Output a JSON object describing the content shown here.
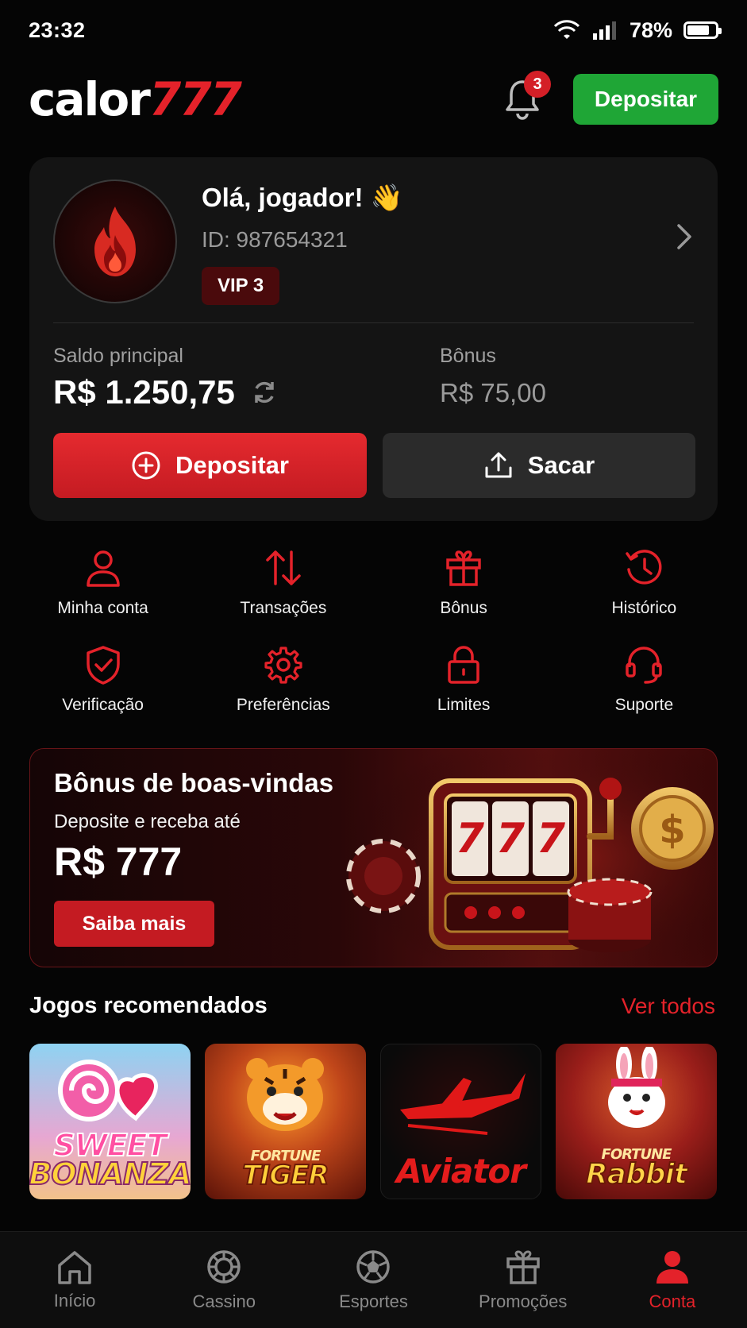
{
  "status": {
    "time": "23:32",
    "battery": "78%",
    "battery_level": 0.78
  },
  "header": {
    "logo_part1": "calor",
    "logo_part2": "777",
    "notification_count": "3",
    "deposit_label": "Depositar"
  },
  "profile": {
    "greeting": "Olá, jogador! 👋",
    "id": "ID: 987654321",
    "vip": "VIP 3",
    "main_balance_label": "Saldo principal",
    "main_balance": "R$ 1.250,75",
    "bonus_label": "Bônus",
    "bonus_value": "R$ 75,00",
    "deposit_label": "Depositar",
    "withdraw_label": "Sacar"
  },
  "actions": [
    {
      "label": "Minha conta",
      "icon": "user-icon"
    },
    {
      "label": "Transações",
      "icon": "arrows-swap-icon"
    },
    {
      "label": "Bônus",
      "icon": "gift-icon"
    },
    {
      "label": "Histórico",
      "icon": "history-icon"
    },
    {
      "label": "Verificação",
      "icon": "shield-check-icon"
    },
    {
      "label": "Preferências",
      "icon": "gear-icon"
    },
    {
      "label": "Limites",
      "icon": "lock-icon"
    },
    {
      "label": "Suporte",
      "icon": "headset-icon"
    }
  ],
  "promo": {
    "title": "Bônus de boas-vindas",
    "subtitle": "Deposite e receba até",
    "amount": "R$ 777",
    "button": "Saiba mais",
    "slot_symbols": [
      "7",
      "7",
      "7"
    ],
    "coin_symbol": "$"
  },
  "games_section": {
    "title": "Jogos recomendados",
    "link": "Ver todos",
    "games": [
      {
        "line1": "SWEET",
        "line2": "BONANZA"
      },
      {
        "line1": "FORTUNE",
        "line2": "TIGER"
      },
      {
        "line1": "",
        "line2": "Aviator"
      },
      {
        "line1": "FORTUNE",
        "line2": "Rabbit"
      }
    ]
  },
  "nav": {
    "items": [
      {
        "label": "Início",
        "icon": "home-icon"
      },
      {
        "label": "Cassino",
        "icon": "casino-chip-icon"
      },
      {
        "label": "Esportes",
        "icon": "soccer-ball-icon"
      },
      {
        "label": "Promoções",
        "icon": "gift-icon"
      },
      {
        "label": "Conta",
        "icon": "user-icon"
      }
    ],
    "active_index": 4
  },
  "colors": {
    "accent": "#e4222a",
    "success": "#1fa636",
    "background": "#050505",
    "card": "#141414"
  }
}
